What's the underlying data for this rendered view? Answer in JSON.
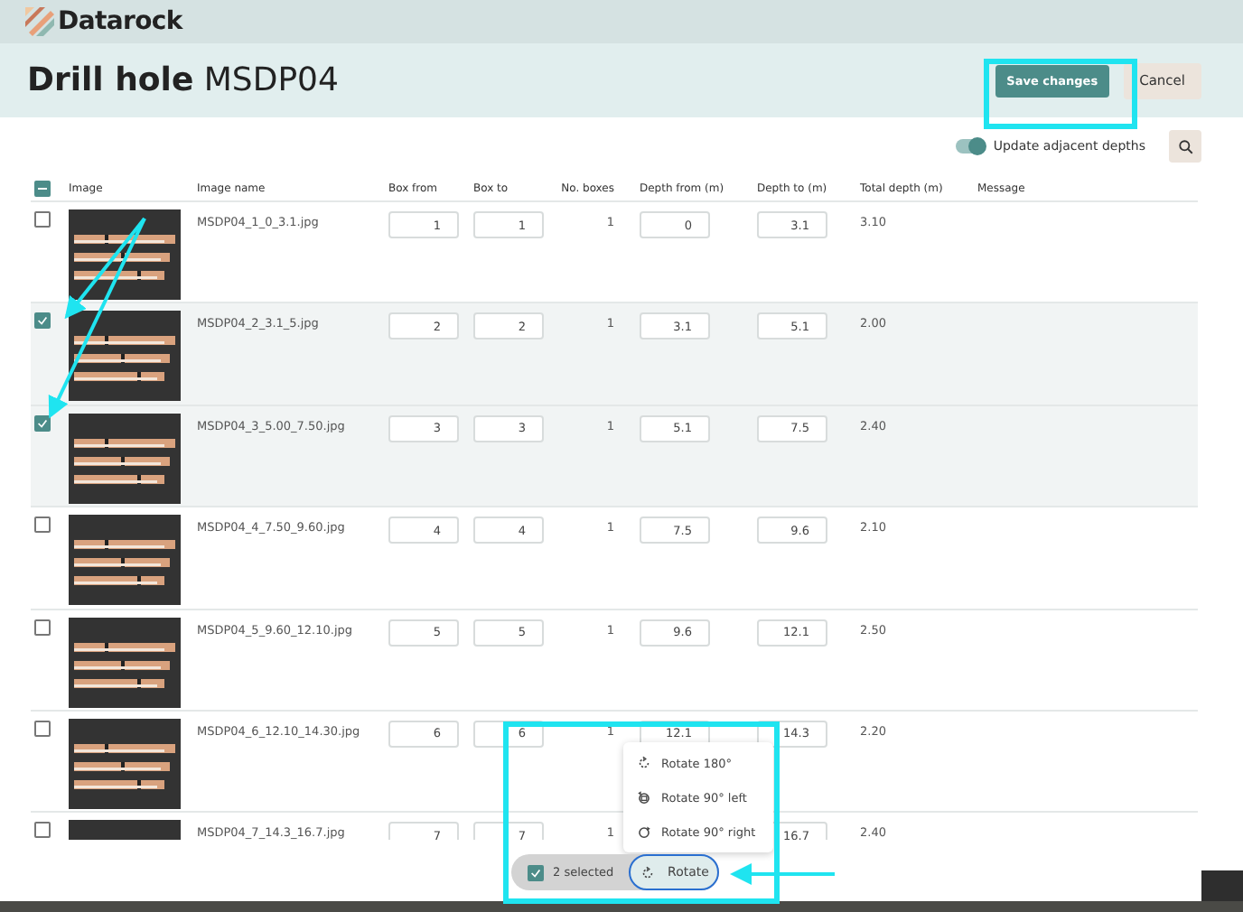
{
  "app": {
    "logo_text": "Datarock"
  },
  "header": {
    "title": "Drill hole",
    "subtitle": "MSDP04",
    "buttons": [
      {
        "label": "Save  changes",
        "kind": "primary"
      },
      {
        "label": "Cancel",
        "kind": "secondary"
      }
    ]
  },
  "toolbar": {
    "toggle": {
      "label": "Update adjacent depths",
      "on": true
    }
  },
  "table": {
    "select_all_indeterminate": true,
    "columns": [
      "Image",
      "Image name",
      "Box from",
      "Box to",
      "No. boxes",
      "Depth from (m)",
      "Depth to (m)",
      "Total depth (m)",
      "Message"
    ],
    "rows": [
      {
        "selected": false,
        "name": "MSDP04_1_0_3.1.jpg",
        "box_from": "1",
        "box_to": "1",
        "boxes": "1",
        "depth_from": "0",
        "depth_to": "3.1",
        "total": "3.10"
      },
      {
        "selected": true,
        "name": "MSDP04_2_3.1_5.jpg",
        "box_from": "2",
        "box_to": "2",
        "boxes": "1",
        "depth_from": "3.1",
        "depth_to": "5.1",
        "total": "2.00"
      },
      {
        "selected": true,
        "name": "MSDP04_3_5.00_7.50.jpg",
        "box_from": "3",
        "box_to": "3",
        "boxes": "1",
        "depth_from": "5.1",
        "depth_to": "7.5",
        "total": "2.40"
      },
      {
        "selected": false,
        "name": "MSDP04_4_7.50_9.60.jpg",
        "box_from": "4",
        "box_to": "4",
        "boxes": "1",
        "depth_from": "7.5",
        "depth_to": "9.6",
        "total": "2.10"
      },
      {
        "selected": false,
        "name": "MSDP04_5_9.60_12.10.jpg",
        "box_from": "5",
        "box_to": "5",
        "boxes": "1",
        "depth_from": "9.6",
        "depth_to": "12.1",
        "total": "2.50"
      },
      {
        "selected": false,
        "name": "MSDP04_6_12.10_14.30.jpg",
        "box_from": "6",
        "box_to": "6",
        "boxes": "1",
        "depth_from": "12.1",
        "depth_to": "14.3",
        "total": "2.20"
      },
      {
        "selected": false,
        "name": "MSDP04_7_14.3_16.7.jpg",
        "box_from": "7",
        "box_to": "7",
        "boxes": "1",
        "depth_to": "16.7",
        "total": "2.40"
      }
    ]
  },
  "rotate_menu": {
    "items": [
      {
        "label": "Rotate 180°",
        "kind": "half"
      },
      {
        "label": "Rotate 90° left",
        "kind": "left"
      },
      {
        "label": "Rotate 90° right",
        "kind": "right"
      }
    ]
  },
  "selection_bar": {
    "checked": true,
    "count_label": "2 selected",
    "action": "Rotate"
  }
}
